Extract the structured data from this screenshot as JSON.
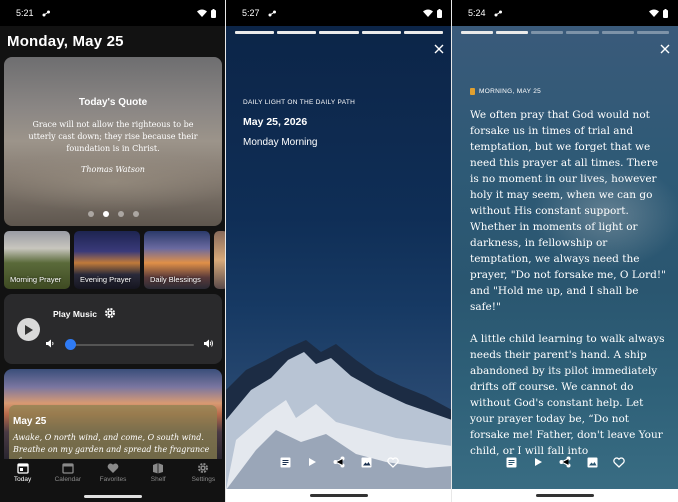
{
  "phone1": {
    "status_time": "5:21",
    "header_date": "Monday, May 25",
    "quote": {
      "title": "Today's Quote",
      "text": "Grace will not allow the righteous to be utterly cast down; they rise because their foundation is in Christ.",
      "author": "Thomas Watson",
      "page_count": 4,
      "active_page": 2
    },
    "tiles": [
      "Morning Prayer",
      "Evening Prayer",
      "Daily Blessings"
    ],
    "music": {
      "label": "Play Music",
      "volume": 0.0
    },
    "verse": {
      "date": "May 25",
      "text": "Awake, O north wind, and come, O south wind. Breathe on my garden and spread the fragrance of"
    },
    "nav": [
      {
        "label": "Today",
        "icon": "calendar-today-icon",
        "active": true
      },
      {
        "label": "Calendar",
        "icon": "calendar-icon",
        "active": false
      },
      {
        "label": "Favorites",
        "icon": "heart-icon",
        "active": false
      },
      {
        "label": "Shelf",
        "icon": "shelf-icon",
        "active": false
      },
      {
        "label": "Settings",
        "icon": "gear-icon",
        "active": false
      }
    ]
  },
  "phone2": {
    "status_time": "5:27",
    "progress_segments": 5,
    "progress_done": 5,
    "kicker": "DAILY LIGHT ON THE DAILY PATH",
    "date": "May 25, 2026",
    "subtitle": "Monday Morning"
  },
  "phone3": {
    "status_time": "5:24",
    "progress_segments": 6,
    "progress_done": 2,
    "kicker": "MORNING, MAY 25",
    "paragraphs": [
      "We often pray that God would not forsake us in times of trial and temptation, but we forget that we need this prayer at all times. There is no moment in our lives, however holy it may seem, when we can go without His constant support. Whether in moments of light or darkness, in fellowship or temptation, we always need the prayer, \"Do not forsake me, O Lord!\" and \"Hold me up, and I shall be safe!\"",
      "A little child learning to walk always needs their parent's hand. A ship abandoned by its pilot immediately drifts off course. We cannot do without God's constant help. Let your prayer today be, “Do not forsake me! Father, don't leave Your child, or I will fall into"
    ]
  },
  "colors": {
    "accent": "#2f7bf5",
    "background": "#121212",
    "card": "#2a2a2c"
  }
}
